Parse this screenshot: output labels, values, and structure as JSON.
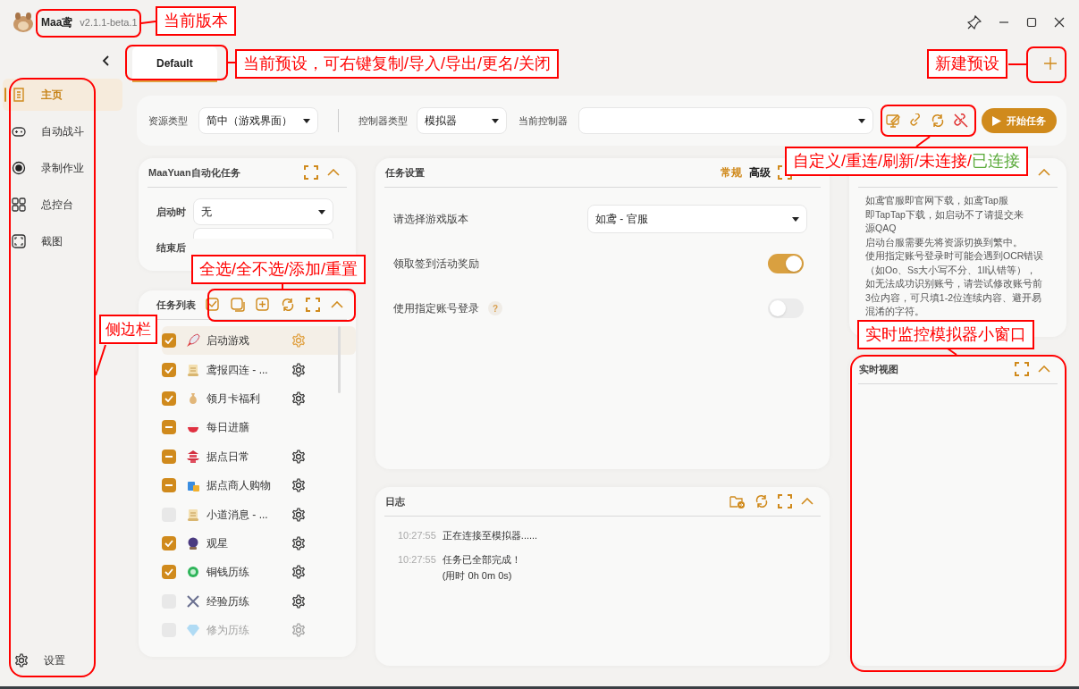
{
  "window": {
    "app_name": "Maa鸢",
    "version": "v2.1.1-beta.1"
  },
  "sidebar": {
    "items": [
      {
        "label": "主页",
        "selected": true
      },
      {
        "label": "自动战斗",
        "selected": false
      },
      {
        "label": "录制作业",
        "selected": false
      },
      {
        "label": "总控台",
        "selected": false
      },
      {
        "label": "截图",
        "selected": false
      }
    ],
    "settings": "设置"
  },
  "tabs": [
    {
      "label": "Default",
      "selected": true
    }
  ],
  "controls": {
    "resource_label": "资源类型",
    "resource_value": "简中（游戏界面）",
    "controller_type_label": "控制器类型",
    "controller_type_value": "模拟器",
    "current_controller_label": "当前控制器",
    "start_button": "开始任务"
  },
  "automation_card": {
    "title": "MaaYuan自动化任务",
    "rows": [
      {
        "label": "启动时",
        "value": "无"
      },
      {
        "label": "结束后"
      }
    ]
  },
  "task_list": {
    "title": "任务列表",
    "tasks": [
      {
        "label": "启动游戏",
        "checked": true,
        "partial": false,
        "selected": true,
        "has_settings": true,
        "dimmed": false
      },
      {
        "label": "鸢报四连 - ...",
        "checked": true,
        "partial": false,
        "selected": false,
        "has_settings": true,
        "dimmed": false
      },
      {
        "label": "领月卡福利",
        "checked": true,
        "partial": false,
        "selected": false,
        "has_settings": true,
        "dimmed": false
      },
      {
        "label": "每日进膳",
        "checked": true,
        "partial": true,
        "selected": false,
        "has_settings": false,
        "dimmed": false
      },
      {
        "label": "据点日常",
        "checked": true,
        "partial": true,
        "selected": false,
        "has_settings": true,
        "dimmed": false
      },
      {
        "label": "据点商人购物",
        "checked": true,
        "partial": true,
        "selected": false,
        "has_settings": true,
        "dimmed": false
      },
      {
        "label": "小道消息 - ...",
        "checked": false,
        "partial": false,
        "selected": false,
        "has_settings": true,
        "dimmed": false
      },
      {
        "label": "观星",
        "checked": true,
        "partial": false,
        "selected": false,
        "has_settings": true,
        "dimmed": false
      },
      {
        "label": "铜钱历练",
        "checked": true,
        "partial": false,
        "selected": false,
        "has_settings": true,
        "dimmed": false
      },
      {
        "label": "经验历练",
        "checked": false,
        "partial": false,
        "selected": false,
        "has_settings": true,
        "dimmed": false
      },
      {
        "label": "修为历练",
        "checked": false,
        "partial": false,
        "selected": false,
        "has_settings": true,
        "dimmed": true
      }
    ]
  },
  "task_settings": {
    "title": "任务设置",
    "modes": [
      {
        "label": "常规",
        "selected": true
      },
      {
        "label": "高级",
        "selected": false
      }
    ],
    "rows": [
      {
        "kind": "select",
        "label": "请选择游戏版本",
        "value": "如鸢 - 官服"
      },
      {
        "kind": "toggle",
        "label": "领取签到活动奖励",
        "on": true
      },
      {
        "kind": "toggle",
        "label": "使用指定账号登录",
        "on": false,
        "help": "?"
      }
    ]
  },
  "log": {
    "title": "日志",
    "entries": [
      {
        "time": "10:27:55",
        "lines": [
          "正在连接至模拟器......"
        ]
      },
      {
        "time": "10:27:55",
        "lines": [
          "任务已全部完成！",
          "(用时 0h 0m 0s)"
        ]
      }
    ]
  },
  "info_card": {
    "lines": [
      "如鸢官服即官网下载，如鸢Tap服",
      "即TapTap下载，如启动不了请提交来",
      "源QAQ",
      "启动台服需要先将资源切换到繁中。",
      "使用指定账号登录时可能会遇到OCR错误",
      "（如Oo、Ss大小写不分、1lI认错等），",
      "如无法成功识别账号，请尝试修改账号前",
      "3位内容，可只填1-2位连续内容、避开易",
      "混淆的字符。"
    ]
  },
  "live_view": {
    "title": "实时视图"
  },
  "annotations": [
    {
      "segments": [
        {
          "text": "当前版本",
          "color": "#ff0000"
        }
      ]
    },
    {
      "segments": [
        {
          "text": "当前预设，可右键复制/导入/导出/更名/关闭",
          "color": "#ff0000"
        }
      ]
    },
    {
      "segments": [
        {
          "text": "新建预设",
          "color": "#ff0000"
        }
      ]
    },
    {
      "segments": [
        {
          "text": "自定义/重连/刷新/未连接/",
          "color": "#ff0000"
        },
        {
          "text": "已连接",
          "color": "#5aaa3a"
        }
      ]
    },
    {
      "segments": [
        {
          "text": "全选/全不选/添加/重置",
          "color": "#ff0000"
        }
      ]
    },
    {
      "segments": [
        {
          "text": "侧边栏",
          "color": "#ff0000"
        }
      ]
    },
    {
      "segments": [
        {
          "text": "实时监控模拟器小窗口",
          "color": "#ff0000"
        }
      ]
    }
  ]
}
